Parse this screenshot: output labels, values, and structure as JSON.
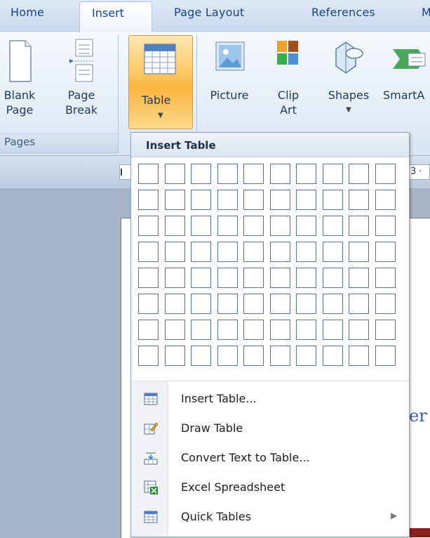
{
  "tabs": {
    "home": "Home",
    "insert": "Insert",
    "page_layout": "Page Layout",
    "references": "References",
    "mailings": "M"
  },
  "ribbon": {
    "blank_page": "Blank\nPage",
    "page_break": "Page\nBreak",
    "pages_group": "Pages",
    "table": "Table",
    "picture": "Picture",
    "clip_art": "Clip\nArt",
    "shapes": "Shapes",
    "smartart": "SmartA"
  },
  "ruler": {
    "number": "3 ·"
  },
  "page": {
    "fragment": "er"
  },
  "dropdown": {
    "header": "Insert Table",
    "grid": {
      "rows": 8,
      "cols": 10
    },
    "items": [
      {
        "label": "Insert Table...",
        "icon": "insert-table-icon"
      },
      {
        "label": "Draw Table",
        "icon": "draw-table-icon"
      },
      {
        "label": "Convert Text to Table...",
        "icon": "convert-text-icon"
      },
      {
        "label": "Excel Spreadsheet",
        "icon": "excel-spreadsheet-icon"
      },
      {
        "label": "Quick Tables",
        "icon": "quick-tables-icon",
        "submenu": true
      }
    ]
  },
  "colors": {
    "accent": "#fbc45a",
    "tab_text": "#15428b",
    "grid_border": "#5c6f8c"
  }
}
